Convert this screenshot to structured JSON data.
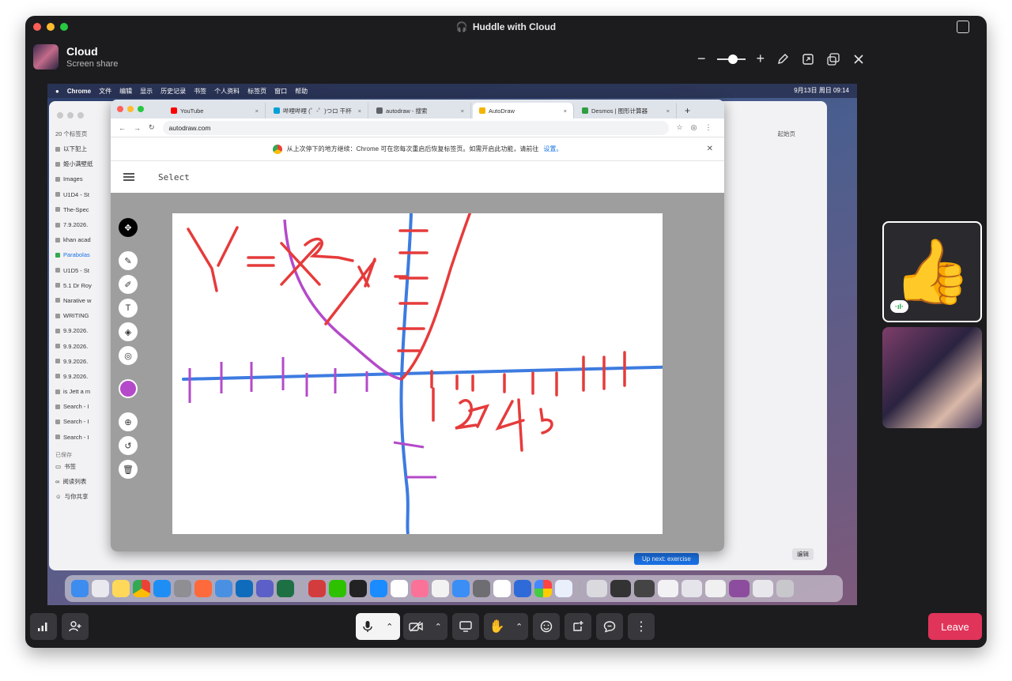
{
  "window": {
    "title": "Huddle with Cloud"
  },
  "share": {
    "name": "Cloud",
    "subtitle": "Screen share",
    "zoom_minus": "−",
    "zoom_plus": "+"
  },
  "mac": {
    "menus": [
      "Chrome",
      "文件",
      "编辑",
      "显示",
      "历史记录",
      "书签",
      "个人资料",
      "标签页",
      "窗口",
      "帮助"
    ],
    "clock": "9月13日 周日 09:14"
  },
  "sidebar": {
    "header": "20 个标签页",
    "items": [
      "以下犯上",
      "姬小满壁纸",
      "Images",
      "U1D4 - St",
      "The-Spec",
      "7.9.2026.",
      "khan acad",
      "Parabolas",
      "U1D5 - St",
      "5.1 Dr Roy",
      "Narative w",
      "WRITING",
      "9.9.2026.",
      "9.9.2026.",
      "9.9.2026.",
      "9.9.2026.",
      "is Jett a m",
      "Search - I",
      "Search - I",
      "Search - I"
    ],
    "saved_header": "已保存",
    "saved_items": [
      "书签",
      "阅读列表",
      "与你共享"
    ]
  },
  "chrome": {
    "tabs": [
      {
        "label": "YouTube",
        "color": "#ff0000"
      },
      {
        "label": "哔哩哔哩 (゜-゜)つロ 干杯",
        "color": "#00a1d6"
      },
      {
        "label": "autodraw - 搜索",
        "color": "#5f6368"
      },
      {
        "label": "AutoDraw",
        "color": "#f4b400"
      },
      {
        "label": "Desmos | 图形计算器",
        "color": "#2e9e3f"
      }
    ],
    "url": "autodraw.com",
    "info_text": "从上次停下的地方继续：Chrome 可在您每次重启后恢复标签页。如需开启此功能，请前往",
    "info_link": "设置。",
    "next_button": "Up next: exercise",
    "edit_label": "编辑",
    "home_label": "起始页"
  },
  "autodraw": {
    "header_title": "Select",
    "selected_color": "#b44ac9"
  },
  "participants": {
    "thumb_emoji": "👍",
    "speaking_indicator": "·ıl·"
  },
  "controls": {
    "leave_label": "Leave"
  }
}
